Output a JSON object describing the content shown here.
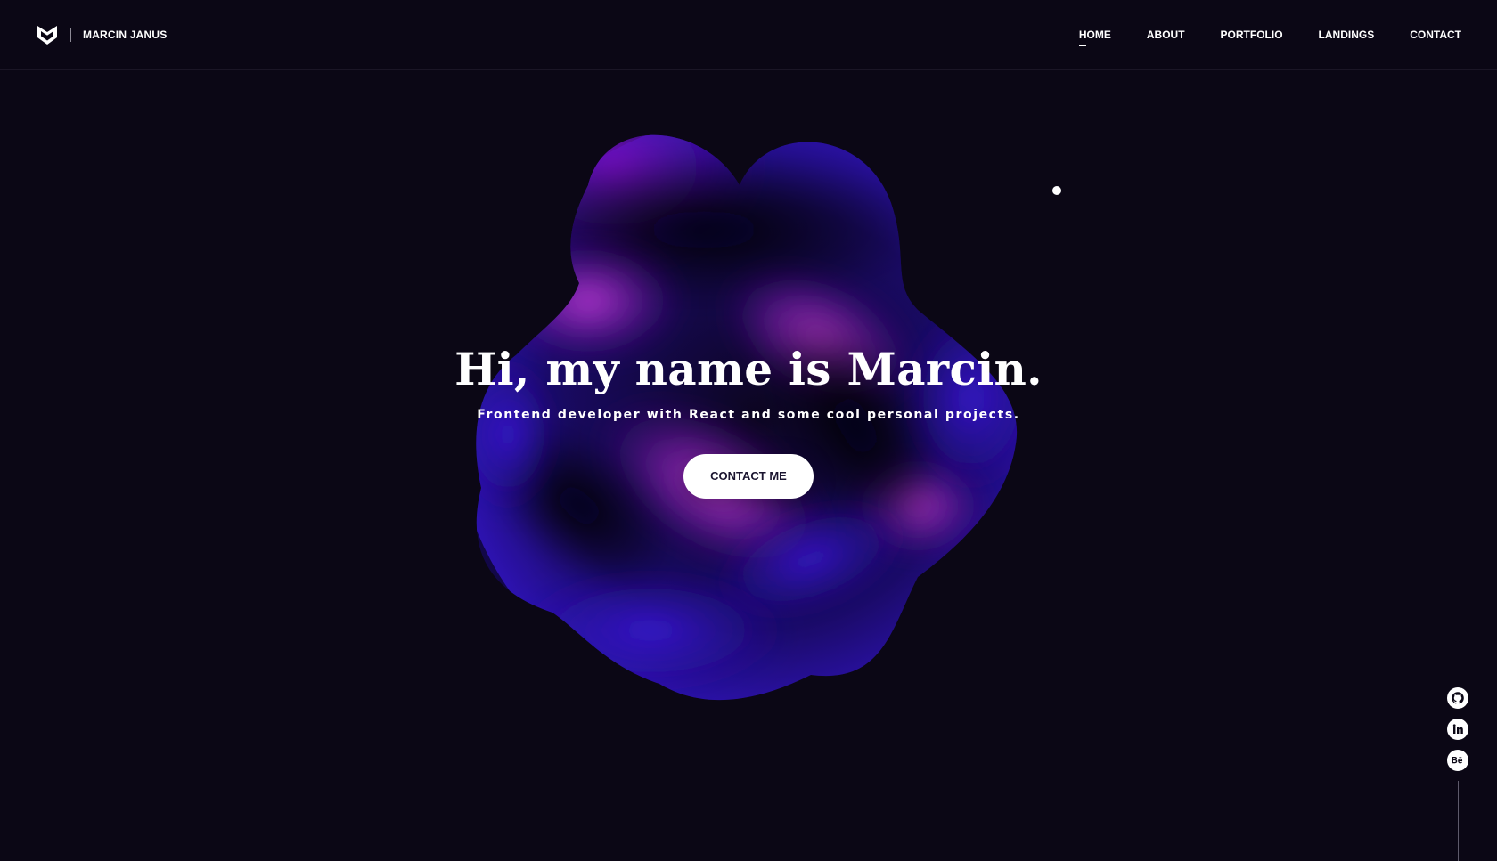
{
  "header": {
    "brand_name": "MARCIN JANUS",
    "logo_icon": "shield-m-logo-icon",
    "nav": [
      {
        "label": "HOME",
        "active": true
      },
      {
        "label": "ABOUT",
        "active": false
      },
      {
        "label": "PORTFOLIO",
        "active": false
      },
      {
        "label": "LANDINGS",
        "active": false
      },
      {
        "label": "CONTACT",
        "active": false
      }
    ]
  },
  "hero": {
    "title": "Hi, my name is Marcin.",
    "subtitle": "Frontend developer with React and some cool personal projects.",
    "cta_label": "CONTACT ME"
  },
  "social": [
    {
      "icon": "github-icon"
    },
    {
      "icon": "linkedin-icon",
      "glyph": "in"
    },
    {
      "icon": "behance-icon",
      "glyph": "Bē"
    }
  ],
  "colors": {
    "background": "#0b0715",
    "blob_purple": "#7b1fc4",
    "blob_blue": "#2b0fa8",
    "blob_dark": "#04020f",
    "text": "#ffffff",
    "cta_text": "#1b1530"
  }
}
